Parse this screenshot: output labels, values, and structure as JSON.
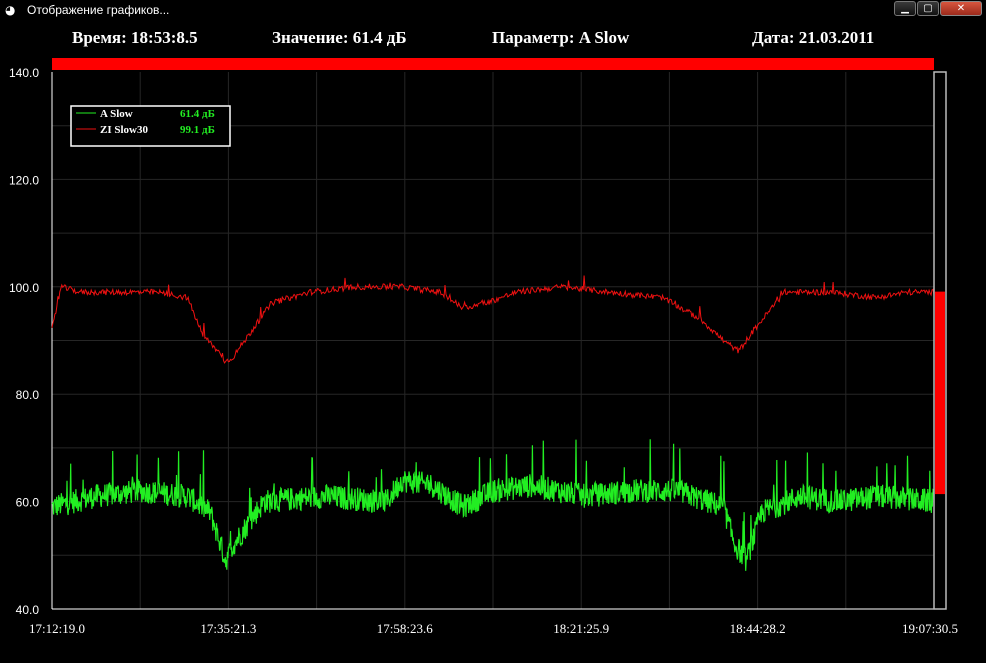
{
  "window": {
    "title": "Отображение графиков...",
    "icon": "app-icon",
    "buttons": {
      "minimize": "▁",
      "maximize": "▢",
      "close": "✕"
    }
  },
  "header": {
    "time": "Время: 18:53:8.5",
    "value": "Значение: 61.4 дБ",
    "parameter": "Параметр: A Slow",
    "date": "Дата: 21.03.2011"
  },
  "chart_data": {
    "type": "line",
    "ylim": [
      40,
      140
    ],
    "y_ticks": [
      "40.0",
      "60.0",
      "80.0",
      "100.0",
      "120.0",
      "140.0"
    ],
    "x_ticks": [
      "17:12:19.0",
      "17:35:21.3",
      "17:58:23.6",
      "18:21:25.9",
      "18:44:28.2",
      "19:07:30.5"
    ],
    "grid": true,
    "legend_position": "top-left",
    "colors": {
      "background": "#000000",
      "grid": "#262626",
      "axis": "#ffffff",
      "level_bar": "#ff0000"
    },
    "series": [
      {
        "name": "A Slow",
        "legend_value": "61.4 дБ",
        "color": "#22ee22",
        "x": [
          "17:12:19",
          "17:18:00",
          "17:24:00",
          "17:30:00",
          "17:33:00",
          "17:35:00",
          "17:36:00",
          "17:40:00",
          "17:48:00",
          "17:56:00",
          "17:58:00",
          "18:02:00",
          "18:06:00",
          "18:10:00",
          "18:15:00",
          "18:22:00",
          "18:28:00",
          "18:34:00",
          "18:40:00",
          "18:41:30",
          "18:43:00",
          "18:45:00",
          "18:50:00",
          "18:55:00",
          "19:00:00",
          "19:07:30"
        ],
        "values": [
          59,
          61,
          62,
          61,
          58,
          49,
          52,
          60,
          61,
          60,
          64,
          63,
          59,
          62,
          63,
          61,
          62,
          62,
          59,
          52,
          49,
          58,
          61,
          60,
          61,
          60
        ]
      },
      {
        "name": "ZI Slow30",
        "legend_value": "99.1 дБ",
        "color": "#ee1111",
        "x": [
          "17:12:19",
          "17:13:30",
          "17:16:00",
          "17:20:00",
          "17:26:00",
          "17:30:00",
          "17:32:00",
          "17:34:00",
          "17:35:00",
          "17:36:00",
          "17:38:00",
          "17:41:00",
          "17:46:00",
          "17:52:00",
          "17:58:00",
          "18:03:00",
          "18:06:00",
          "18:09:00",
          "18:13:00",
          "18:19:00",
          "18:25:00",
          "18:32:00",
          "18:37:00",
          "18:40:00",
          "18:42:00",
          "18:44:00",
          "18:48:00",
          "18:54:00",
          "19:00:00",
          "19:04:00",
          "19:07:30"
        ],
        "values": [
          92,
          100,
          99,
          99,
          99,
          98,
          91,
          88,
          86,
          87,
          91,
          97,
          99,
          100,
          100,
          99,
          96,
          97,
          99,
          100,
          99,
          98,
          94,
          90,
          88,
          92,
          99,
          99,
          98,
          99,
          99
        ]
      }
    ],
    "level_indicator": {
      "min": 40,
      "max": 140,
      "value": 61.4,
      "peak": 99.1
    }
  }
}
